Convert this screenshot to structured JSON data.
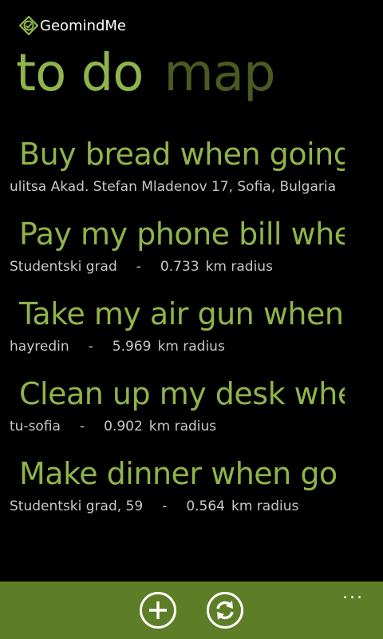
{
  "app": {
    "title": "GeomindMe"
  },
  "pivot": {
    "items": [
      {
        "label": "to do",
        "active": true
      },
      {
        "label": "map",
        "active": false
      }
    ]
  },
  "tasks": [
    {
      "title": "Buy bread when going",
      "location": "ulitsa Akad. Stefan Mladenov 17, Sofia, Bulgaria",
      "separator": "",
      "radius": "",
      "unit": ""
    },
    {
      "title": "Pay my phone bill when",
      "location": "Studentski grad",
      "separator": "-",
      "radius": "0.733",
      "unit": "km radius"
    },
    {
      "title": "Take my air gun when",
      "location": "hayredin",
      "separator": "-",
      "radius": "5.969",
      "unit": "km radius"
    },
    {
      "title": "Clean up my desk when",
      "location": "tu-sofia",
      "separator": "-",
      "radius": "0.902",
      "unit": "km radius"
    },
    {
      "title": "Make dinner when go",
      "location": "Studentski grad, 59",
      "separator": "-",
      "radius": "0.564",
      "unit": "km radius"
    }
  ],
  "app_bar": {
    "buttons": [
      {
        "icon": "add-icon"
      },
      {
        "icon": "refresh-icon"
      }
    ],
    "more_label": "..."
  },
  "colors": {
    "accent": "#8fb44a",
    "accent_dim": "#4a5a22",
    "app_bar_bg": "#5e7d27",
    "background": "#000000"
  }
}
